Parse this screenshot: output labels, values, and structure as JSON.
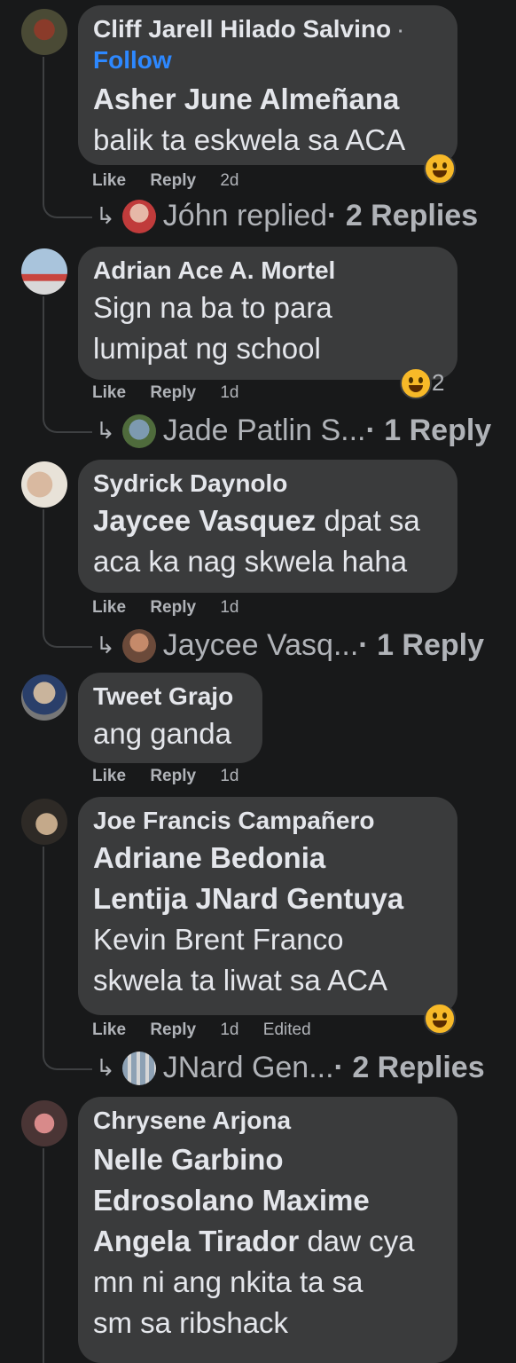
{
  "comments": [
    {
      "author": "Cliff Jarell Hilado Salvino",
      "dot": "·",
      "follow": "Follow",
      "mention": "Asher June Almeñana",
      "text": "balik ta eskwela sa ACA",
      "actions": {
        "like": "Like",
        "reply": "Reply",
        "time": "2d"
      },
      "replies": {
        "who": "Jóhn replied",
        "count": "· 2 Replies"
      }
    },
    {
      "author": "Adrian Ace A. Mortel",
      "text_lines": [
        "Sign na ba to para",
        "lumipat ng school"
      ],
      "reaction_count": "2",
      "actions": {
        "like": "Like",
        "reply": "Reply",
        "time": "1d"
      },
      "replies": {
        "who": "Jade Patlin S...",
        "count": " · 1 Reply"
      }
    },
    {
      "author": "Sydrick Daynolo",
      "mention": "Jaycee Vasquez",
      "text_a": " dpat sa",
      "text_b": "aca ka nag skwela haha",
      "actions": {
        "like": "Like",
        "reply": "Reply",
        "time": "1d"
      },
      "replies": {
        "who": "Jaycee Vasq...",
        "count": "  · 1 Reply"
      }
    },
    {
      "author": "Tweet Grajo",
      "text": "ang ganda",
      "actions": {
        "like": "Like",
        "reply": "Reply",
        "time": "1d"
      }
    },
    {
      "author": "Joe Francis Campañero",
      "mention1": "Adriane Bedonia",
      "mention2": "Lentija JNard Gentuya",
      "text_a": "Kevin Brent Franco",
      "text_b": "skwela ta liwat sa ACA",
      "actions": {
        "like": "Like",
        "reply": "Reply",
        "time": "1d",
        "edited": "Edited"
      },
      "replies": {
        "who": "JNard Gen...",
        "count": " · 2 Replies"
      }
    },
    {
      "author": "Chrysene Arjona",
      "mention1": "Nelle Garbino",
      "mention2": "Edrosolano Maxime",
      "mention3": "Angela Tirador",
      "text_a": " daw cya",
      "text_b": "mn ni ang nkita ta sa",
      "text_c": "sm sa ribshack"
    }
  ],
  "icons": {
    "reply_arrow": "reply-arrow-icon",
    "reaction": "haha-reaction-icon"
  },
  "colors": {
    "background": "#18191a",
    "bubble": "#3a3b3c",
    "text": "#e4e6eb",
    "secondary": "#b0b3b8",
    "link": "#2d88ff"
  }
}
